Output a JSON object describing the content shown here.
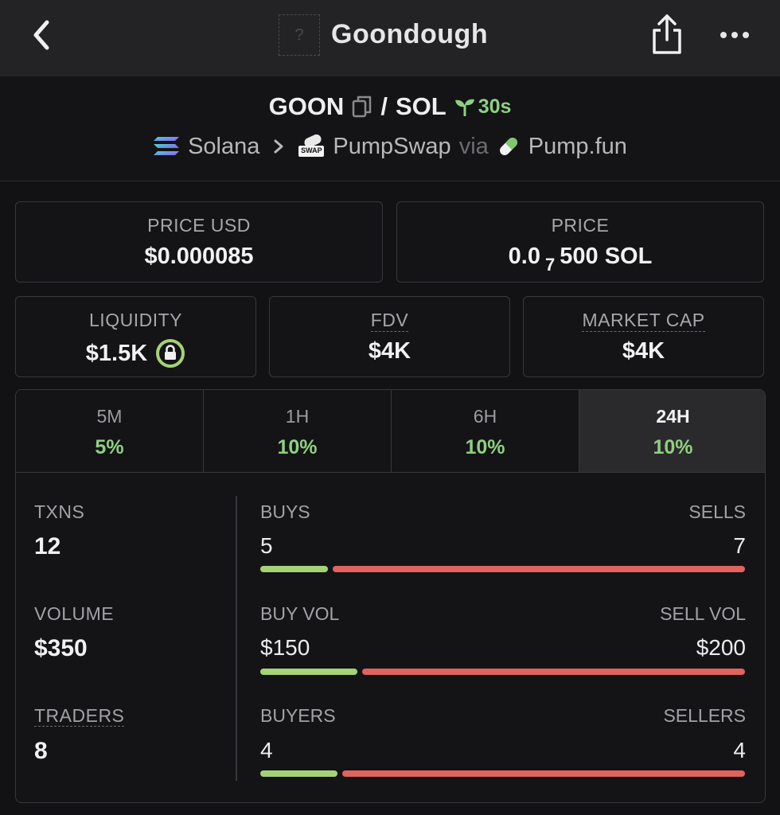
{
  "header": {
    "title": "Goondough",
    "logo_placeholder": "?"
  },
  "pair": {
    "base": "GOON",
    "separator": "/",
    "quote": "SOL",
    "age": "30s",
    "chain": "Solana",
    "dex": "PumpSwap",
    "via": "via",
    "launchpad": "Pump.fun",
    "dex_badge": "SWAP"
  },
  "prices": {
    "price_usd_label": "PRICE USD",
    "price_usd": "$0.000085",
    "price_label": "PRICE",
    "price_prefix": "0.0",
    "price_zero_count": "7",
    "price_suffix": "500 SOL"
  },
  "metrics": {
    "liquidity_label": "LIQUIDITY",
    "liquidity": "$1.5K",
    "fdv_label": "FDV",
    "fdv": "$4K",
    "mcap_label": "MARKET CAP",
    "mcap": "$4K"
  },
  "timeframes": [
    {
      "label": "5M",
      "change": "5%"
    },
    {
      "label": "1H",
      "change": "10%"
    },
    {
      "label": "6H",
      "change": "10%"
    },
    {
      "label": "24H",
      "change": "10%"
    }
  ],
  "active_timeframe": 3,
  "stats": {
    "txns_label": "TXNS",
    "txns": "12",
    "volume_label": "VOLUME",
    "volume": "$350",
    "traders_label": "TRADERS",
    "traders": "8",
    "buys_label": "BUYS",
    "buys": "5",
    "sells_label": "SELLS",
    "sells": "7",
    "buy_vol_label": "BUY VOL",
    "buy_vol": "$150",
    "sell_vol_label": "SELL VOL",
    "sell_vol": "$200",
    "buyers_label": "BUYERS",
    "buyers": "4",
    "sellers_label": "SELLERS",
    "sellers": "4",
    "buy_share": {
      "txns": 0.14,
      "volume": 0.2,
      "traders": 0.16
    }
  },
  "colors": {
    "positive": "#8fd080",
    "buy_bar": "#a6d276",
    "sell_bar": "#e0635e",
    "background": "#121214",
    "topbar": "#232326"
  },
  "icons": {
    "back": "chevron-left-icon",
    "share": "share-icon",
    "more": "more-icon",
    "copy": "copy-icon",
    "sprout": "sprout-icon",
    "chain": "solana-icon",
    "dex": "pumpswap-icon",
    "launchpad": "pill-icon",
    "lock": "lock-icon"
  }
}
